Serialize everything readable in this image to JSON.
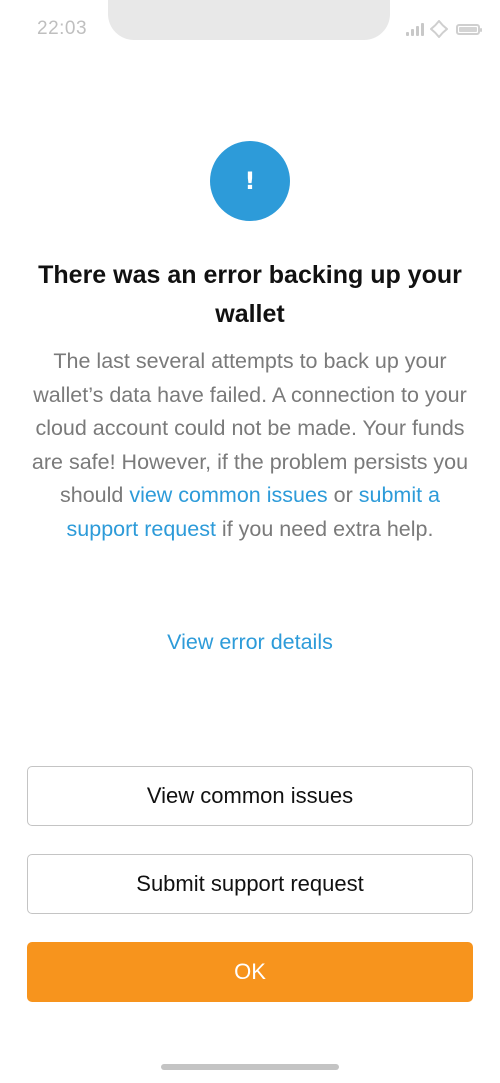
{
  "status_bar": {
    "time": "22:03",
    "icons": [
      "signal-icon",
      "wifi-icon",
      "battery-icon"
    ]
  },
  "alert": {
    "icon_glyph": "!",
    "icon_color": "#2d9bd9"
  },
  "title": "There was an error backing up your wallet",
  "message": {
    "text_before": "The last several attempts to back up your wallet’s data have failed. A connection to your cloud account could not be made. Your funds are safe! However, if the problem persists you should ",
    "link_common_issues": "view common issues",
    "text_between": " or ",
    "link_support": "submit a support request",
    "text_after": " if you need extra help."
  },
  "details_link": "View error details",
  "buttons": {
    "common_issues": "View common issues",
    "support": "Submit support request",
    "ok": "OK"
  },
  "colors": {
    "accent": "#2d9bd9",
    "primary_button": "#f7941d",
    "body_text": "#7a7a7a"
  }
}
